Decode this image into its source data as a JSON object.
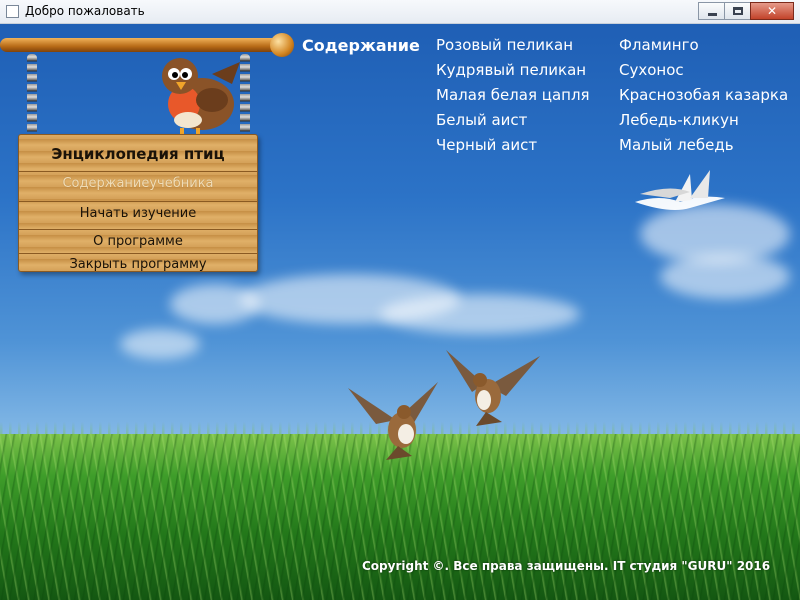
{
  "window": {
    "title": "Добро пожаловать",
    "buttons": [
      "minimize",
      "maximize",
      "close"
    ],
    "close_glyph": "✕"
  },
  "signboard": {
    "title": "Энциклопедия птиц",
    "items": [
      {
        "label": "Содержаниеучебника",
        "enabled": false
      },
      {
        "label": "Начать изучение",
        "enabled": true
      },
      {
        "label": "О программе",
        "enabled": true
      },
      {
        "label": "Закрыть программу",
        "enabled": true
      }
    ]
  },
  "contents": {
    "heading": "Содержание",
    "column1": [
      "Розовый пеликан",
      "Кудрявый пеликан",
      "Малая белая цапля",
      "Белый аист",
      "Черный аист"
    ],
    "column2": [
      "Фламинго",
      "Сухонос",
      "Краснозобая казарка",
      "Лебедь-кликун",
      "Малый лебедь"
    ]
  },
  "footer": {
    "copyright": "Copyright ©. Все права защищены. IT студия \"GURU\" 2016"
  },
  "icons": {
    "app": "window-app-icon",
    "mascot": "robin-bird-icon",
    "swans": "flying-swans-icon",
    "hummingbirds": "hummingbird-icon"
  },
  "colors": {
    "sky_top": "#1f5fb5",
    "sky_bottom": "#b9d9f2",
    "grass": "#23781a",
    "board": "#d4a058",
    "menu_text": "#ffffff"
  }
}
